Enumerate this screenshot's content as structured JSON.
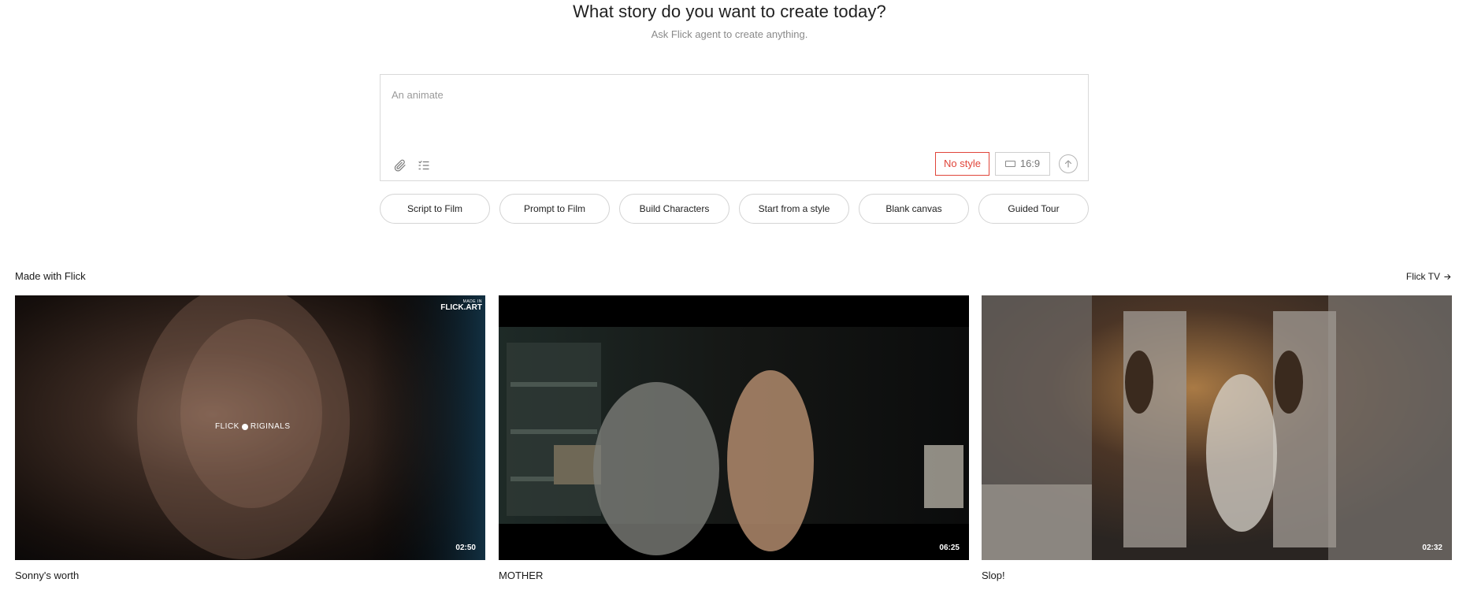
{
  "header": {
    "title": "What story do you want to create today?",
    "subtitle": "Ask Flick agent to create anything."
  },
  "composer": {
    "value": "An animate",
    "attach_icon": "paperclip-icon",
    "tasks_icon": "checklist-icon",
    "style_label": "No style",
    "ratio_label": "16:9",
    "send_icon": "arrow-up-icon",
    "accent_color": "#e0453a"
  },
  "chips": [
    {
      "label": "Script to Film"
    },
    {
      "label": "Prompt to Film"
    },
    {
      "label": "Build Characters"
    },
    {
      "label": "Start from a style"
    },
    {
      "label": "Blank canvas"
    },
    {
      "label": "Guided Tour"
    }
  ],
  "gallery": {
    "title": "Made with Flick",
    "link_label": "Flick TV",
    "link_icon": "arrow-right-icon",
    "cards": [
      {
        "title": "Sonny's worth",
        "duration": "02:50",
        "watermark_small": "MADE IN",
        "watermark_big": "FLICK.ART",
        "overlay_text_left": "FLICK",
        "overlay_text_right": "RIGINALS"
      },
      {
        "title": "MOTHER",
        "duration": "06:25"
      },
      {
        "title": "Slop!",
        "duration": "02:32"
      }
    ]
  }
}
